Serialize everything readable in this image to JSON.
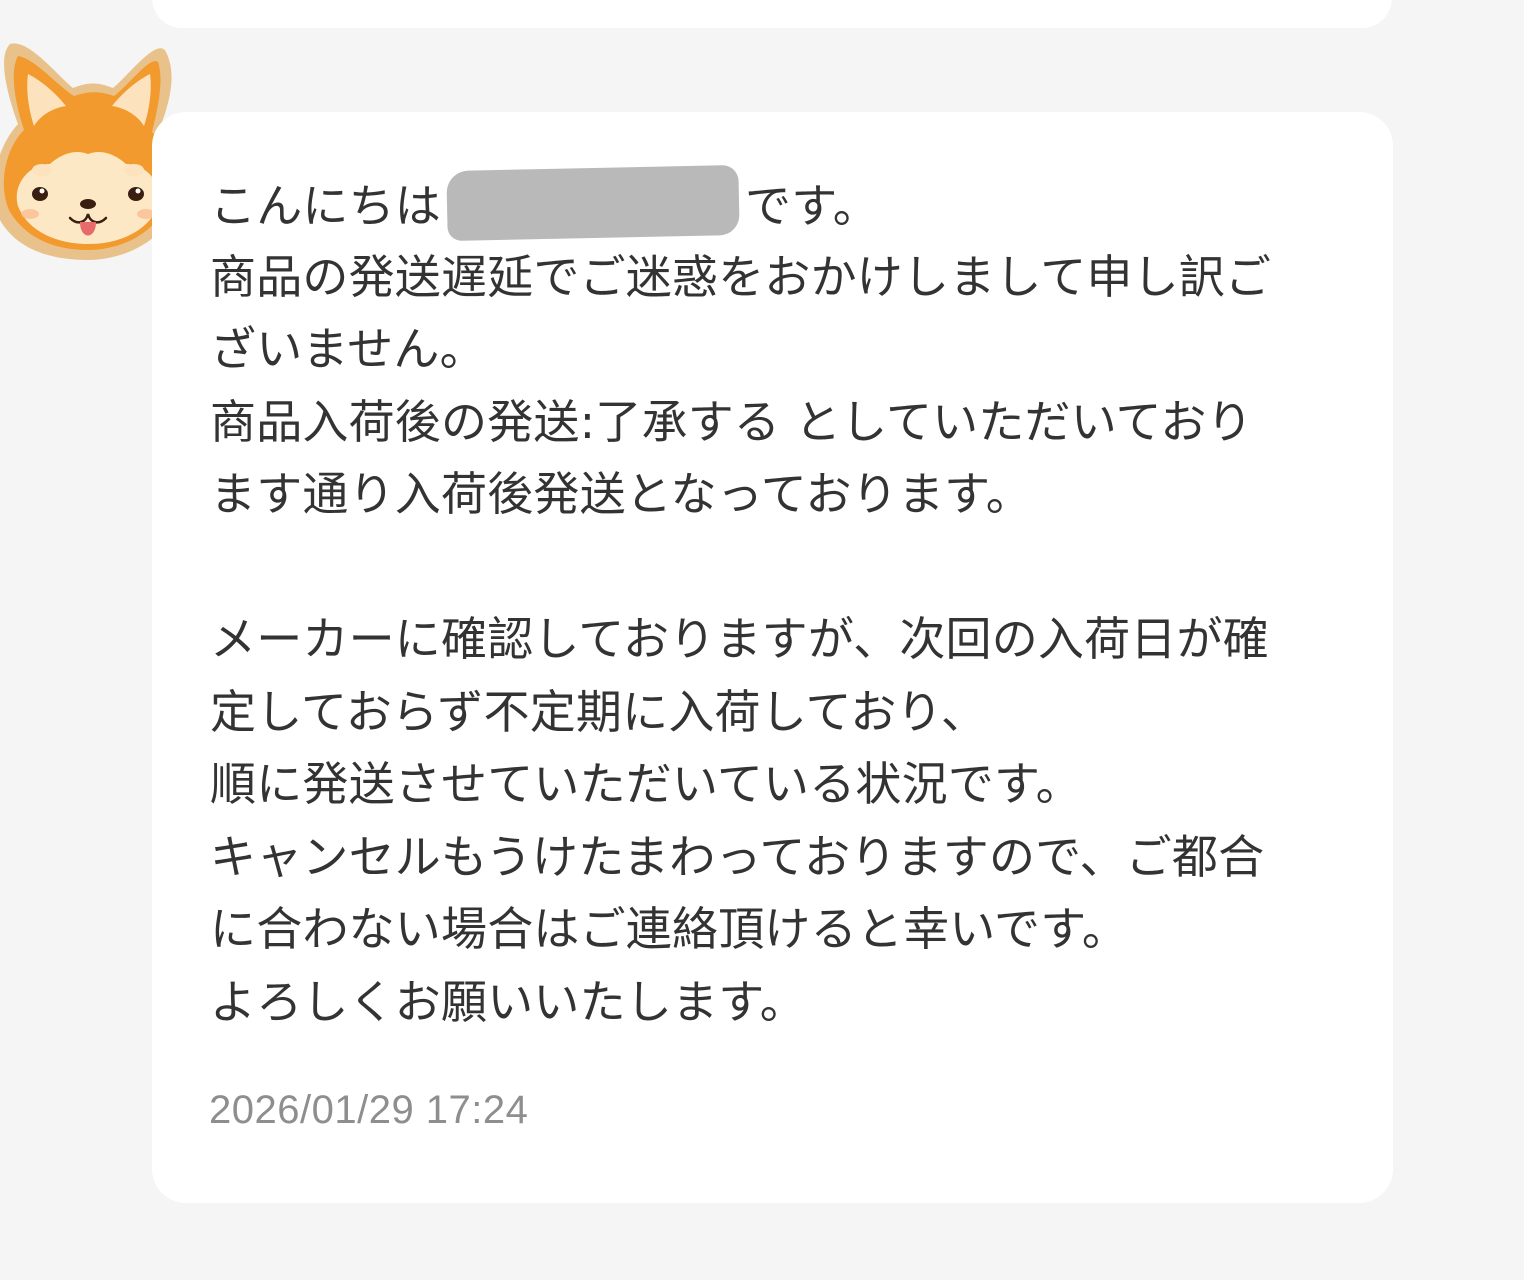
{
  "message": {
    "greeting_prefix": "こんにちは",
    "greeting_suffix": "です。",
    "lines_1": [
      "商品の発送遅延でご迷惑をおかけしまして申し訳ご",
      "ざいません。",
      "商品入荷後の発送:了承する としていただいており",
      "ます通り入荷後発送となっております。"
    ],
    "lines_2": [
      "メーカーに確認しておりますが、次回の入荷日が確",
      "定しておらず不定期に入荷しており、",
      "順に発送させていただいている状況です。",
      "キャンセルもうけたまわっておりますので、ご都合",
      "に合わない場合はご連絡頂けると幸いです。",
      "よろしくお願いいたします。"
    ],
    "timestamp": "2026/01/29 17:24"
  },
  "icons": {
    "avatar": "shiba-dog-avatar-icon"
  },
  "colors": {
    "background": "#f5f5f5",
    "bubble": "#ffffff",
    "text": "#333333",
    "timestamp": "#8e8e8e",
    "redaction": "#b9b9b9",
    "avatar_fur": "#f29a2e"
  }
}
